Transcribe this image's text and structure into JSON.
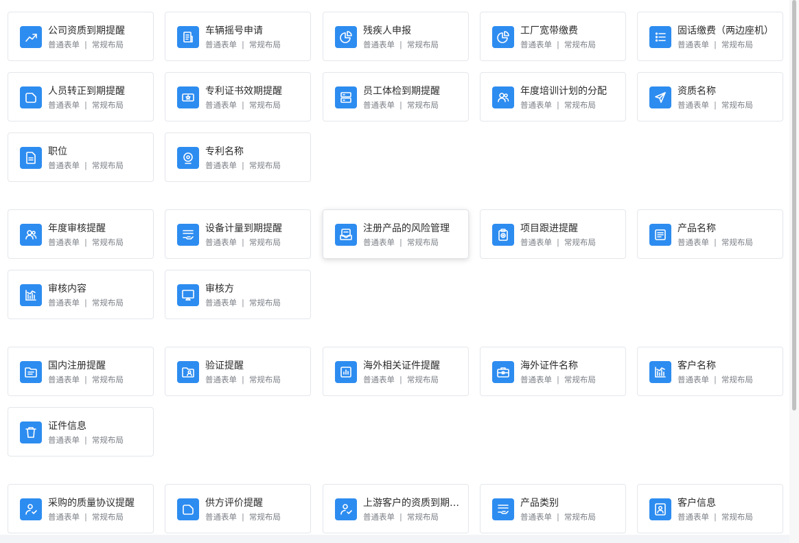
{
  "meta": {
    "type_label": "普通表单",
    "separator": "|",
    "layout_label": "常规布局"
  },
  "groups": [
    {
      "cards": [
        {
          "title": "公司资质到期提醒",
          "icon": "trend-up-icon"
        },
        {
          "title": "车辆摇号申请",
          "icon": "document-list-icon"
        },
        {
          "title": "残疾人申报",
          "icon": "pie-chart-icon"
        },
        {
          "title": "工厂宽带缴费",
          "icon": "pie-chart-icon"
        },
        {
          "title": "固话缴费（两边座机）",
          "icon": "list-icon"
        },
        {
          "title": "人员转正到期提醒",
          "icon": "tag-icon"
        },
        {
          "title": "专利证书效期提醒",
          "icon": "ticket-icon"
        },
        {
          "title": "员工体检到期提醒",
          "icon": "server-icon"
        },
        {
          "title": "年度培训计划的分配",
          "icon": "users-icon"
        },
        {
          "title": "资质名称",
          "icon": "send-icon"
        },
        {
          "title": "职位",
          "icon": "file-icon"
        },
        {
          "title": "专利名称",
          "icon": "webcam-icon"
        }
      ]
    },
    {
      "cards": [
        {
          "title": "年度审核提醒",
          "icon": "users-icon"
        },
        {
          "title": "设备计量到期提醒",
          "icon": "hand-list-icon"
        },
        {
          "title": "注册产品的风险管理",
          "icon": "inbox-icon"
        },
        {
          "title": "项目跟进提醒",
          "icon": "clipboard-icon"
        },
        {
          "title": "产品名称",
          "icon": "document-icon"
        },
        {
          "title": "审核内容",
          "icon": "bar-chart-icon"
        },
        {
          "title": "审核方",
          "icon": "monitor-icon"
        }
      ]
    },
    {
      "cards": [
        {
          "title": "国内注册提醒",
          "icon": "folder-icon"
        },
        {
          "title": "验证提醒",
          "icon": "folder-user-icon"
        },
        {
          "title": "海外相关证件提醒",
          "icon": "chart-box-icon"
        },
        {
          "title": "海外证件名称",
          "icon": "briefcase-icon"
        },
        {
          "title": "客户名称",
          "icon": "bar-chart-icon"
        },
        {
          "title": "证件信息",
          "icon": "trash-icon"
        }
      ]
    },
    {
      "cards": [
        {
          "title": "采购的质量协议提醒",
          "icon": "user-add-icon"
        },
        {
          "title": "供方评价提醒",
          "icon": "tag-icon"
        },
        {
          "title": "上游客户的资质到期提醒",
          "icon": "user-add-icon"
        },
        {
          "title": "产品类别",
          "icon": "hand-list-icon"
        },
        {
          "title": "客户信息",
          "icon": "id-card-icon"
        }
      ]
    }
  ],
  "hovered_card": "注册产品的风险管理",
  "colors": {
    "icon_bg": "#2d8cf0",
    "title": "#2b2b2b",
    "meta": "#7b7f86",
    "border": "#e3e6eb"
  }
}
